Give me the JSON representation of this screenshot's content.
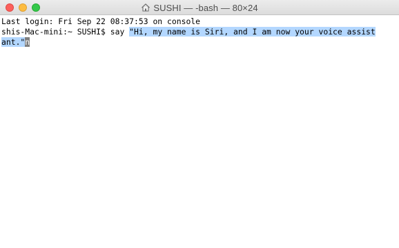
{
  "window": {
    "title": "SUSHI — -bash — 80×24",
    "title_icon": "home-folder-icon"
  },
  "terminal": {
    "login_line": "Last login: Fri Sep 22 08:37:53 on console",
    "prompt": "shis-Mac-mini:~ SUSHI$ ",
    "command": "say ",
    "selected_part1": "\"Hi, my name is Siri, and I am now your voice assist",
    "selected_part2": "ant.\"",
    "cursor_char": "n"
  },
  "colors": {
    "selection": "#b3d7ff",
    "cursor": "#7f7f7f",
    "close": "#fc605c",
    "minimize": "#fdbc40",
    "maximize": "#34c84a"
  }
}
